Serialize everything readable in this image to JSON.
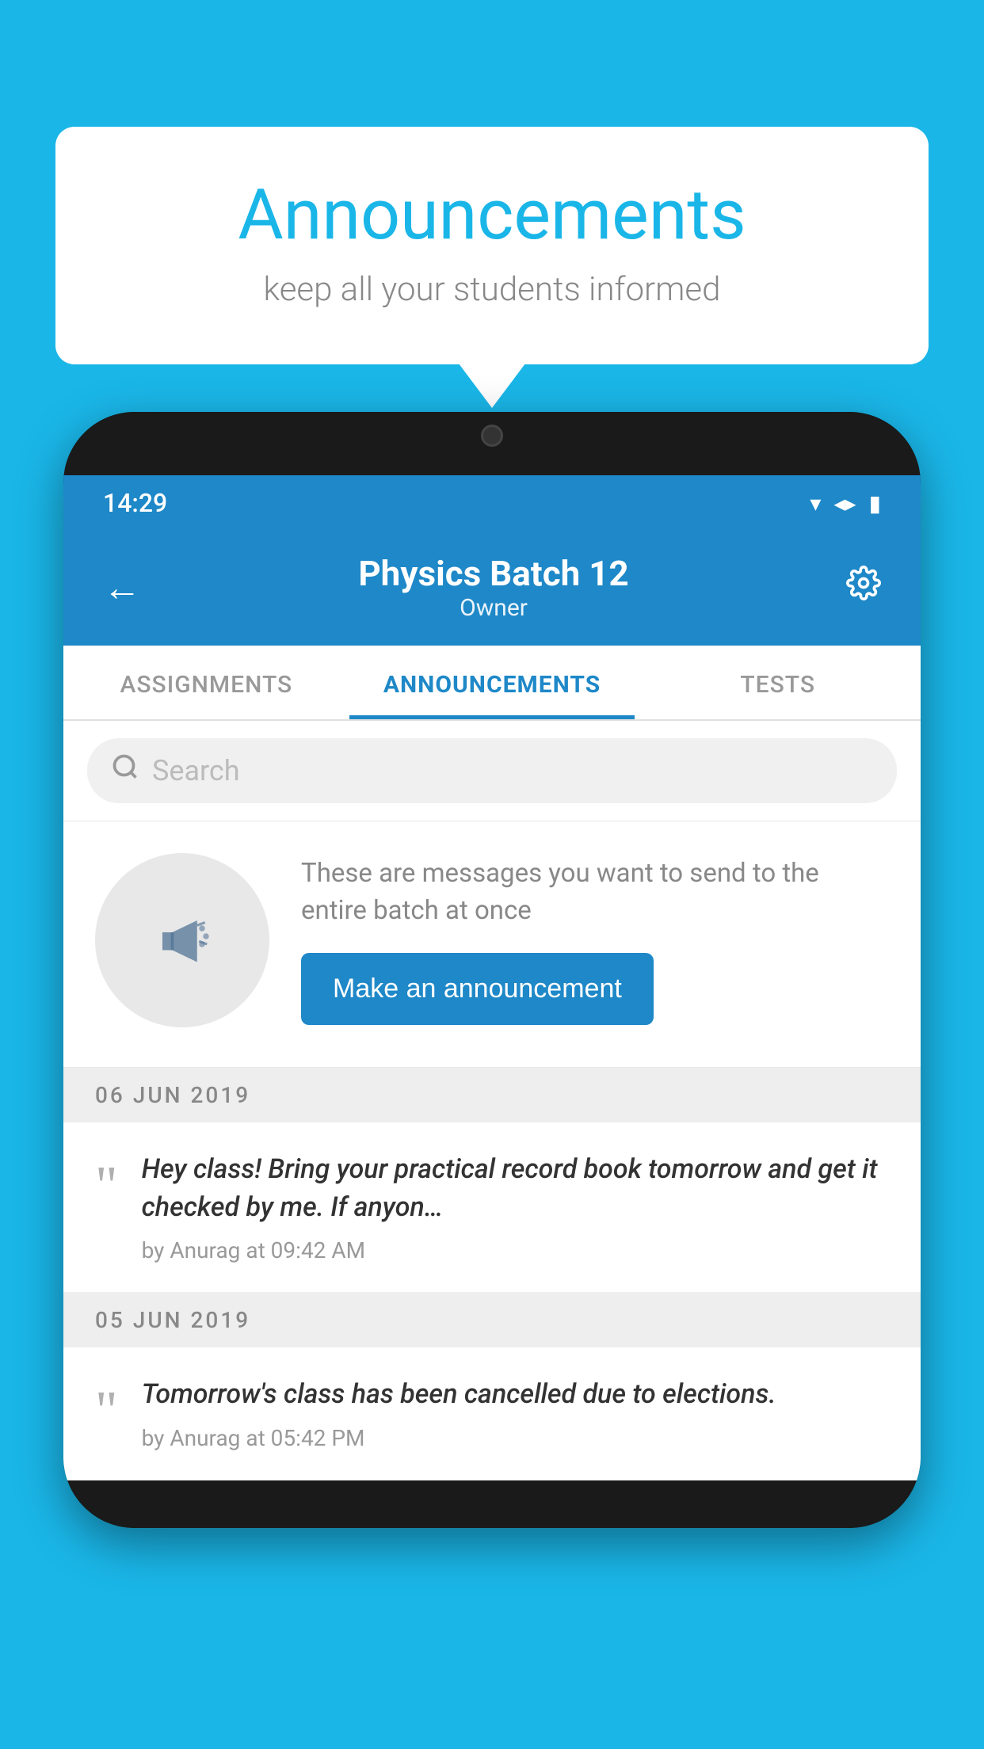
{
  "bubble": {
    "title": "Announcements",
    "subtitle": "keep all your students informed"
  },
  "status_bar": {
    "time": "14:29",
    "wifi": "▼",
    "signal": "▲",
    "battery": "▮"
  },
  "header": {
    "batch_name": "Physics Batch 12",
    "role": "Owner",
    "back_label": "←",
    "settings_label": "⚙"
  },
  "tabs": [
    {
      "label": "ASSIGNMENTS",
      "active": false
    },
    {
      "label": "ANNOUNCEMENTS",
      "active": true
    },
    {
      "label": "TESTS",
      "active": false
    },
    {
      "label": "...",
      "active": false
    }
  ],
  "search": {
    "placeholder": "Search"
  },
  "promo": {
    "description": "These are messages you want to send to the entire batch at once",
    "button_label": "Make an announcement"
  },
  "announcements": [
    {
      "date": "06  JUN  2019",
      "text": "Hey class! Bring your practical record book tomorrow and get it checked by me. If anyon…",
      "meta": "by Anurag at 09:42 AM"
    },
    {
      "date": "05  JUN  2019",
      "text": "Tomorrow's class has been cancelled due to elections.",
      "meta": "by Anurag at 05:42 PM"
    }
  ],
  "colors": {
    "primary": "#1e88c8",
    "background": "#1ab6e8",
    "white": "#ffffff",
    "light_gray": "#f5f5f5",
    "text_dark": "#333333",
    "text_muted": "#888888"
  }
}
